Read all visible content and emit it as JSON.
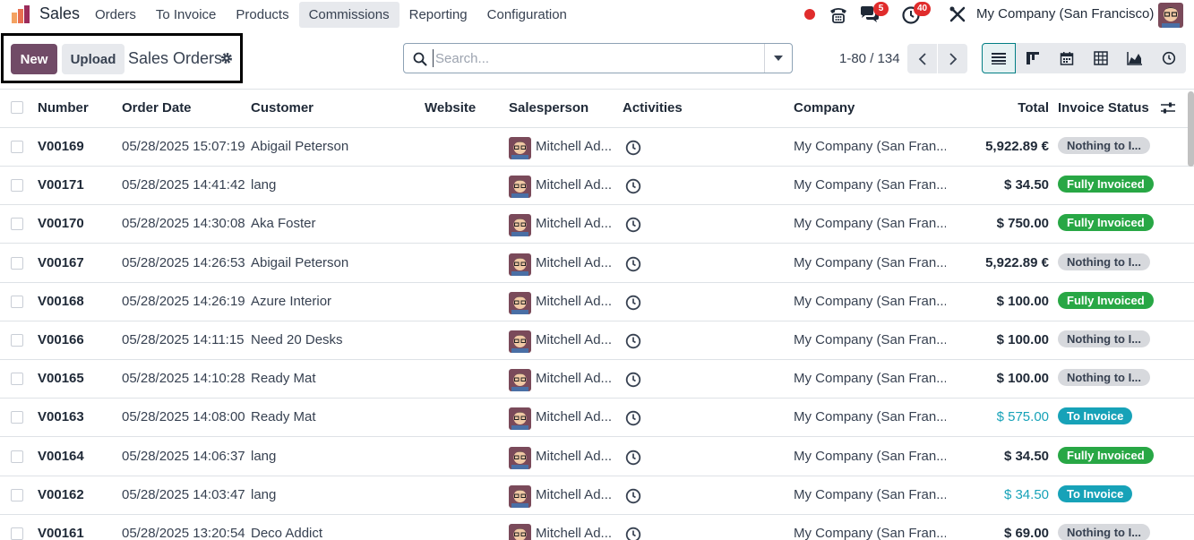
{
  "app": {
    "name": "Sales",
    "brand_color": "#714b67"
  },
  "nav": {
    "items": [
      "Orders",
      "To Invoice",
      "Products",
      "Commissions",
      "Reporting",
      "Configuration"
    ],
    "active": "Commissions",
    "messages_badge": "5",
    "activities_badge": "40",
    "company": "My Company (San Francisco)"
  },
  "control": {
    "new_label": "New",
    "upload_label": "Upload",
    "breadcrumb": "Sales Orders",
    "search_placeholder": "Search...",
    "pager": "1-80 / 134"
  },
  "table": {
    "headers": {
      "number": "Number",
      "order_date": "Order Date",
      "customer": "Customer",
      "website": "Website",
      "salesperson": "Salesperson",
      "activities": "Activities",
      "company": "Company",
      "total": "Total",
      "invoice_status": "Invoice Status"
    },
    "rows": [
      {
        "number": "V00169",
        "date": "05/28/2025 15:07:19",
        "customer": "Abigail Peterson",
        "salesperson": "Mitchell Ad...",
        "company": "My Company (San Fran...",
        "total": "5,922.89 €",
        "total_style": "bold",
        "status": "Nothing to I...",
        "status_type": "nothing"
      },
      {
        "number": "V00171",
        "date": "05/28/2025 14:41:42",
        "customer": "lang",
        "salesperson": "Mitchell Ad...",
        "company": "My Company (San Fran...",
        "total": "$ 34.50",
        "total_style": "bold",
        "status": "Fully Invoiced",
        "status_type": "full"
      },
      {
        "number": "V00170",
        "date": "05/28/2025 14:30:08",
        "customer": "Aka Foster",
        "salesperson": "Mitchell Ad...",
        "company": "My Company (San Fran...",
        "total": "$ 750.00",
        "total_style": "bold",
        "status": "Fully Invoiced",
        "status_type": "full"
      },
      {
        "number": "V00167",
        "date": "05/28/2025 14:26:53",
        "customer": "Abigail Peterson",
        "salesperson": "Mitchell Ad...",
        "company": "My Company (San Fran...",
        "total": "5,922.89 €",
        "total_style": "bold",
        "status": "Nothing to I...",
        "status_type": "nothing"
      },
      {
        "number": "V00168",
        "date": "05/28/2025 14:26:19",
        "customer": "Azure Interior",
        "salesperson": "Mitchell Ad...",
        "company": "My Company (San Fran...",
        "total": "$ 100.00",
        "total_style": "bold",
        "status": "Fully Invoiced",
        "status_type": "full"
      },
      {
        "number": "V00166",
        "date": "05/28/2025 14:11:15",
        "customer": "Need 20 Desks",
        "salesperson": "Mitchell Ad...",
        "company": "My Company (San Fran...",
        "total": "$ 100.00",
        "total_style": "bold",
        "status": "Nothing to I...",
        "status_type": "nothing"
      },
      {
        "number": "V00165",
        "date": "05/28/2025 14:10:28",
        "customer": "Ready Mat",
        "salesperson": "Mitchell Ad...",
        "company": "My Company (San Fran...",
        "total": "$ 100.00",
        "total_style": "bold",
        "status": "Nothing to I...",
        "status_type": "nothing"
      },
      {
        "number": "V00163",
        "date": "05/28/2025 14:08:00",
        "customer": "Ready Mat",
        "salesperson": "Mitchell Ad...",
        "company": "My Company (San Fran...",
        "total": "$ 575.00",
        "total_style": "link",
        "status": "To Invoice",
        "status_type": "toinv"
      },
      {
        "number": "V00164",
        "date": "05/28/2025 14:06:37",
        "customer": "lang",
        "salesperson": "Mitchell Ad...",
        "company": "My Company (San Fran...",
        "total": "$ 34.50",
        "total_style": "bold",
        "status": "Fully Invoiced",
        "status_type": "full"
      },
      {
        "number": "V00162",
        "date": "05/28/2025 14:03:47",
        "customer": "lang",
        "salesperson": "Mitchell Ad...",
        "company": "My Company (San Fran...",
        "total": "$ 34.50",
        "total_style": "link",
        "status": "To Invoice",
        "status_type": "toinv"
      },
      {
        "number": "V00161",
        "date": "05/28/2025 13:20:54",
        "customer": "Deco Addict",
        "salesperson": "Mitchell Ad...",
        "company": "My Company (San Fran...",
        "total": "$ 69.00",
        "total_style": "bold",
        "status": "Nothing to I...",
        "status_type": "nothing"
      }
    ]
  }
}
